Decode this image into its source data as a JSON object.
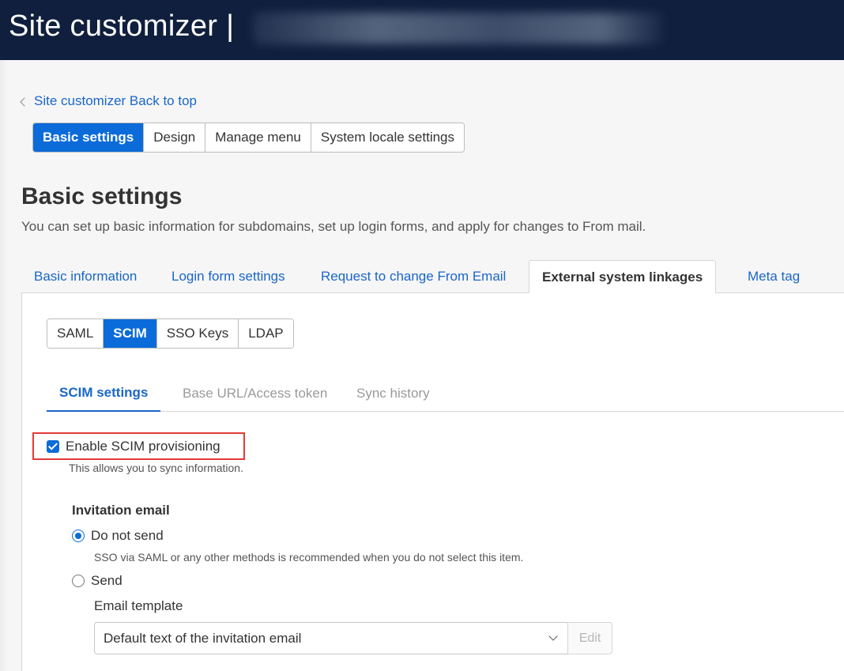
{
  "header": {
    "title": "Site customizer |"
  },
  "breadcrumb": {
    "back_label": "Site customizer Back to top"
  },
  "top_tabs": [
    {
      "label": "Basic settings",
      "active": true
    },
    {
      "label": "Design",
      "active": false
    },
    {
      "label": "Manage menu",
      "active": false
    },
    {
      "label": "System locale settings",
      "active": false
    }
  ],
  "page": {
    "title": "Basic settings",
    "description": "You can set up basic information for subdomains, set up login forms, and apply for changes to From mail."
  },
  "section_tabs": [
    {
      "label": "Basic information",
      "active": false
    },
    {
      "label": "Login form settings",
      "active": false
    },
    {
      "label": "Request to change From Email",
      "active": false
    },
    {
      "label": "External system linkages",
      "active": true
    },
    {
      "label": "Meta tag",
      "active": false
    }
  ],
  "linkage_tabs": [
    {
      "label": "SAML",
      "active": false
    },
    {
      "label": "SCIM",
      "active": true
    },
    {
      "label": "SSO Keys",
      "active": false
    },
    {
      "label": "LDAP",
      "active": false
    }
  ],
  "scim_tabs": [
    {
      "label": "SCIM settings",
      "active": true
    },
    {
      "label": "Base URL/Access token",
      "active": false
    },
    {
      "label": "Sync history",
      "active": false
    }
  ],
  "scim_settings": {
    "enable_label": "Enable SCIM provisioning",
    "enable_checked": true,
    "enable_help": "This allows you to sync information.",
    "invitation_title": "Invitation email",
    "option_do_not_send": "Do not send",
    "option_do_not_send_help": "SSO via SAML or any other methods is recommended when you do not select this item.",
    "option_send": "Send",
    "selected_option": "Do not send",
    "email_template_label": "Email template",
    "email_template_value": "Default text of the invitation email",
    "edit_label": "Edit"
  },
  "colors": {
    "header_bg": "#0f1f3d",
    "accent": "#0b6bd9",
    "link": "#1a66c9",
    "highlight_border": "#e53935"
  },
  "icons": [
    "chevron-left-icon",
    "checkbox-checked-icon",
    "radio-checked-icon",
    "radio-unchecked-icon",
    "chevron-down-icon"
  ]
}
